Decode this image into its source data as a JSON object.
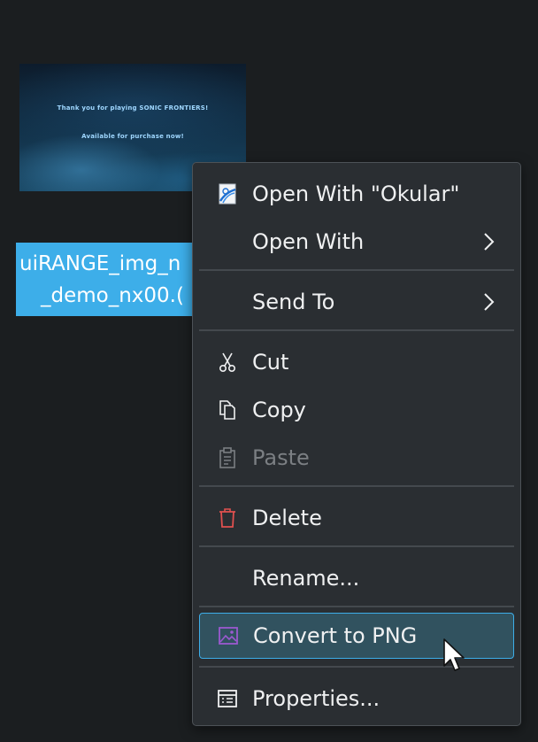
{
  "file": {
    "thumbnail_text": [
      "Thank you for playing SONIC FRONTIERS!",
      "Available for purchase now!"
    ],
    "name_line1": "uiRANGE_img_n",
    "name_line2": "_demo_nx00.("
  },
  "context_menu": {
    "items": [
      {
        "label": "Open With \"Okular\"",
        "icon": "okular-icon"
      },
      {
        "label": "Open With",
        "icon": "",
        "submenu": true
      },
      {
        "label": "Send To",
        "icon": "",
        "submenu": true
      },
      {
        "label": "Cut",
        "icon": "scissors-icon"
      },
      {
        "label": "Copy",
        "icon": "copy-icon"
      },
      {
        "label": "Paste",
        "icon": "clipboard-icon",
        "disabled": true
      },
      {
        "label": "Delete",
        "icon": "trash-icon"
      },
      {
        "label": "Rename...",
        "icon": ""
      },
      {
        "label": "Convert to PNG",
        "icon": "image-icon",
        "highlighted": true
      },
      {
        "label": "Properties...",
        "icon": "properties-icon"
      }
    ]
  },
  "colors": {
    "menu_bg": "#2a2e32",
    "highlight_bg": "#31525f",
    "highlight_border": "#3daee9",
    "selection": "#3daee9",
    "delete_icon": "#e0504f",
    "convert_icon": "#9b59d0"
  }
}
